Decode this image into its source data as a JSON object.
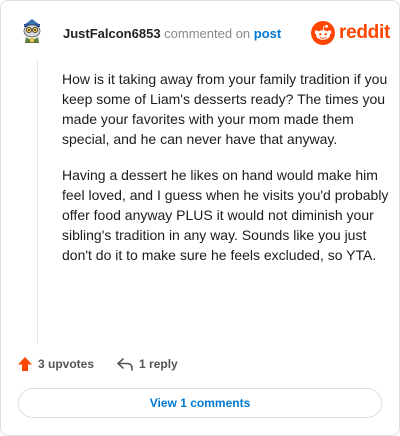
{
  "comment": {
    "username": "JustFalcon6853",
    "action_text": "commented on",
    "post_link": "post",
    "paragraphs": [
      "How is it taking away from your family tradition if you keep some of Liam's desserts ready? The times you made your favorites with your mom made them special, and he can never have that anyway.",
      "Having a dessert he likes on hand would make him feel loved, and I guess when he visits you'd probably offer food anyway PLUS it would not diminish your sibling's tradition in any way. Sounds like you just don't do it to make sure he feels excluded, so YTA."
    ]
  },
  "brand": {
    "wordmark": "reddit",
    "color": "#ff4500"
  },
  "actions": {
    "upvotes_label": "3 upvotes",
    "reply_label": "1 reply"
  },
  "footer": {
    "view_comments_label": "View 1 comments"
  },
  "colors": {
    "link": "#0079d3",
    "upvote": "#ff4500",
    "muted": "#878a8c"
  },
  "icons": {
    "avatar": "snoo-avatar-icon",
    "logo": "reddit-logo-icon",
    "upvote": "upvote-arrow-icon",
    "reply": "reply-arrow-icon"
  }
}
